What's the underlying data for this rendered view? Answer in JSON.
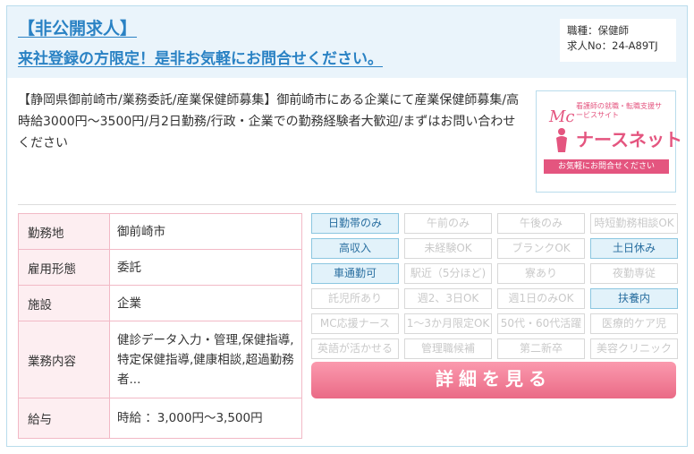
{
  "header": {
    "title": "【非公開求人】",
    "subtitle": "来社登録の方限定！是非お気軽にお問合せください。",
    "job_type": "職種：保健師",
    "job_no": "求人No：24-A89TJ"
  },
  "description": "【静岡県御前崎市/業務委託/産業保健師募集】御前崎市にある企業にて産業保健師募集/高時給3000円～3500円/月2日勤務/行政・企業での勤務経験者大歓迎/まずはお問い合わせください",
  "logo": {
    "tagline": "看護師の就職・転職支援サービスサイト",
    "mc": "Mc",
    "brand": "ナースネット",
    "ribbon": "お気軽にお問合せください"
  },
  "info": [
    {
      "label": "勤務地",
      "value": "御前崎市"
    },
    {
      "label": "雇用形態",
      "value": "委託"
    },
    {
      "label": "施設",
      "value": "企業"
    },
    {
      "label": "業務内容",
      "value": "健診データ入力・管理,保健指導,特定保健指導,健康相談,超過勤務者..."
    },
    {
      "label": "給与",
      "value": "時給 ：3,000円～3,500円"
    }
  ],
  "tags": [
    {
      "label": "日勤帯のみ",
      "active": true
    },
    {
      "label": "午前のみ",
      "active": false
    },
    {
      "label": "午後のみ",
      "active": false
    },
    {
      "label": "時短勤務相談OK",
      "active": false
    },
    {
      "label": "高収入",
      "active": true
    },
    {
      "label": "未経験OK",
      "active": false
    },
    {
      "label": "ブランクOK",
      "active": false
    },
    {
      "label": "土日休み",
      "active": true
    },
    {
      "label": "車通勤可",
      "active": true
    },
    {
      "label": "駅近（5分ほど)",
      "active": false
    },
    {
      "label": "寮あり",
      "active": false
    },
    {
      "label": "夜勤専従",
      "active": false
    },
    {
      "label": "託児所あり",
      "active": false
    },
    {
      "label": "週2、3日OK",
      "active": false
    },
    {
      "label": "週1日のみOK",
      "active": false
    },
    {
      "label": "扶養内",
      "active": true
    },
    {
      "label": "MC応援ナース",
      "active": false
    },
    {
      "label": "1～3か月限定OK",
      "active": false
    },
    {
      "label": "50代・60代活躍",
      "active": false
    },
    {
      "label": "医療的ケア児",
      "active": false
    },
    {
      "label": "英語が活かせる",
      "active": false
    },
    {
      "label": "管理職候補",
      "active": false
    },
    {
      "label": "第二新卒",
      "active": false
    },
    {
      "label": "美容クリニック",
      "active": false
    }
  ],
  "detail_button": "詳細を見る",
  "colors": {
    "accent_blue": "#2a82c4",
    "brand_pink": "#e4557f",
    "tag_active_bg": "#e2f2fa"
  }
}
